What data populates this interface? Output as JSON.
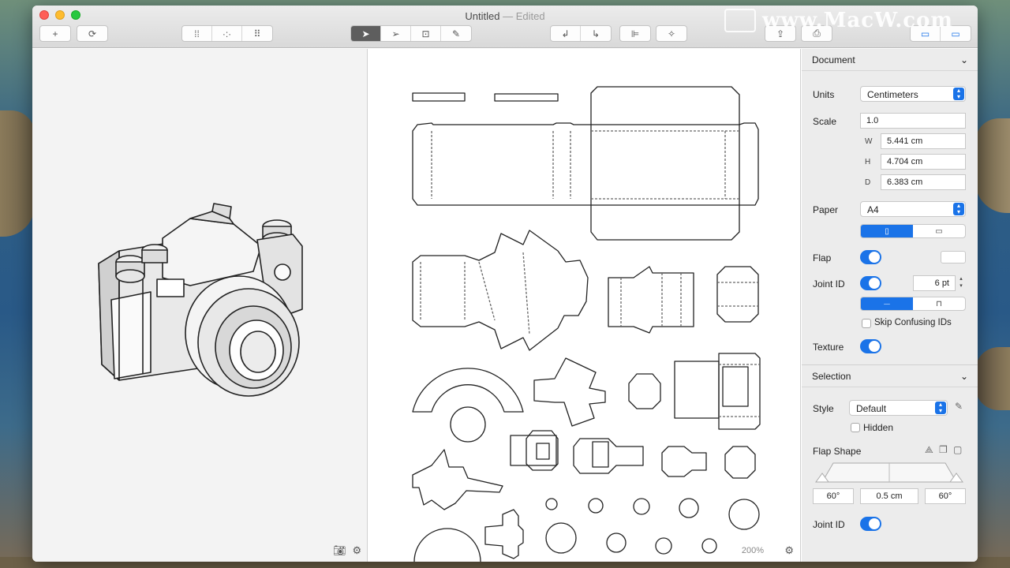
{
  "watermark": {
    "text": "www.MacW.com"
  },
  "window": {
    "title": "Untitled",
    "title_suffix": "— Edited"
  },
  "toolbar": {
    "groups": [
      {
        "icons": [
          "plus-icon"
        ],
        "glyphs": [
          "+"
        ]
      },
      {
        "icons": [
          "refresh-icon"
        ],
        "glyphs": [
          "⟳"
        ]
      },
      {
        "icons": [
          "grid-dots-icon",
          "grid-center-icon",
          "grid-fill-icon"
        ],
        "glyphs": [
          "⁞⁞",
          "·:·",
          "⠿"
        ]
      },
      {
        "icons": [
          "select-tool-icon",
          "direct-select-icon",
          "transform-icon",
          "pencil-icon"
        ],
        "glyphs": [
          "➤",
          "➢",
          "⊡",
          "✎"
        ]
      },
      {
        "icons": [
          "rotate-left-icon",
          "rotate-right-icon"
        ],
        "glyphs": [
          "↲",
          "↳"
        ]
      },
      {
        "icons": [
          "align-icon"
        ],
        "glyphs": [
          "⊫"
        ]
      },
      {
        "icons": [
          "magic-wand-icon"
        ],
        "glyphs": [
          "✧"
        ]
      },
      {
        "icons": [
          "share-icon"
        ],
        "glyphs": [
          "⇪"
        ]
      },
      {
        "icons": [
          "print-icon"
        ],
        "glyphs": [
          "⎙"
        ]
      },
      {
        "icons": [
          "left-sidebar-icon",
          "right-sidebar-icon"
        ],
        "glyphs": [
          "▭",
          "▭"
        ]
      }
    ]
  },
  "canvas": {
    "zoom": "200%"
  },
  "inspector": {
    "document": {
      "title": "Document",
      "units_label": "Units",
      "units_value": "Centimeters",
      "scale_label": "Scale",
      "scale_value": "1.0",
      "w_label": "W",
      "w_value": "5.441 cm",
      "h_label": "H",
      "h_value": "4.704 cm",
      "d_label": "D",
      "d_value": "6.383 cm",
      "paper_label": "Paper",
      "paper_value": "A4",
      "flap_label": "Flap",
      "joint_id_label": "Joint ID",
      "joint_size": "6 pt",
      "skip_label": "Skip Confusing IDs",
      "texture_label": "Texture"
    },
    "selection": {
      "title": "Selection",
      "style_label": "Style",
      "style_value": "Default",
      "hidden_label": "Hidden",
      "flap_shape_label": "Flap Shape",
      "angle_left": "60°",
      "flap_width": "0.5 cm",
      "angle_right": "60°",
      "joint_id_label": "Joint ID"
    }
  },
  "colors": {
    "accent": "#1a73e8",
    "active_tool": "#5e5e5e"
  }
}
